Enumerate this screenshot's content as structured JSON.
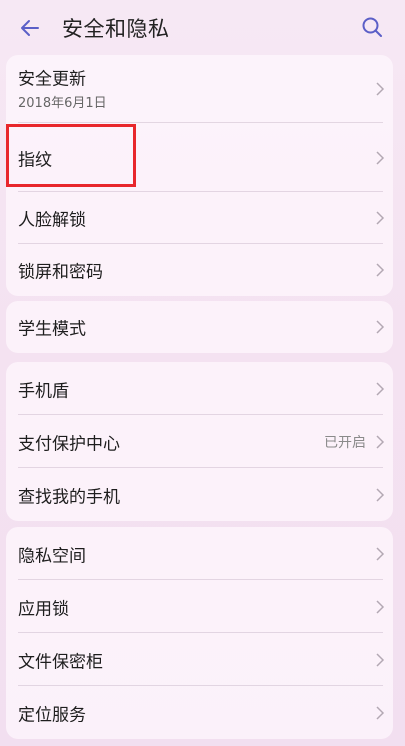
{
  "header": {
    "title": "安全和隐私"
  },
  "icons": {
    "back": "arrow-left-icon",
    "search": "search-icon",
    "chevron": "chevron-right-icon"
  },
  "colors": {
    "accent": "#5b5fc7",
    "highlight": "#e8272c"
  },
  "groups": [
    {
      "items": [
        {
          "label": "安全更新",
          "sub": "2018年6月1日"
        },
        {
          "label": "指纹"
        },
        {
          "label": "人脸解锁"
        },
        {
          "label": "锁屏和密码"
        }
      ]
    },
    {
      "items": [
        {
          "label": "学生模式"
        }
      ]
    },
    {
      "items": [
        {
          "label": "手机盾"
        },
        {
          "label": "支付保护中心",
          "value": "已开启"
        },
        {
          "label": "查找我的手机"
        }
      ]
    },
    {
      "items": [
        {
          "label": "隐私空间"
        },
        {
          "label": "应用锁"
        },
        {
          "label": "文件保密柜"
        },
        {
          "label": "定位服务"
        }
      ]
    }
  ]
}
